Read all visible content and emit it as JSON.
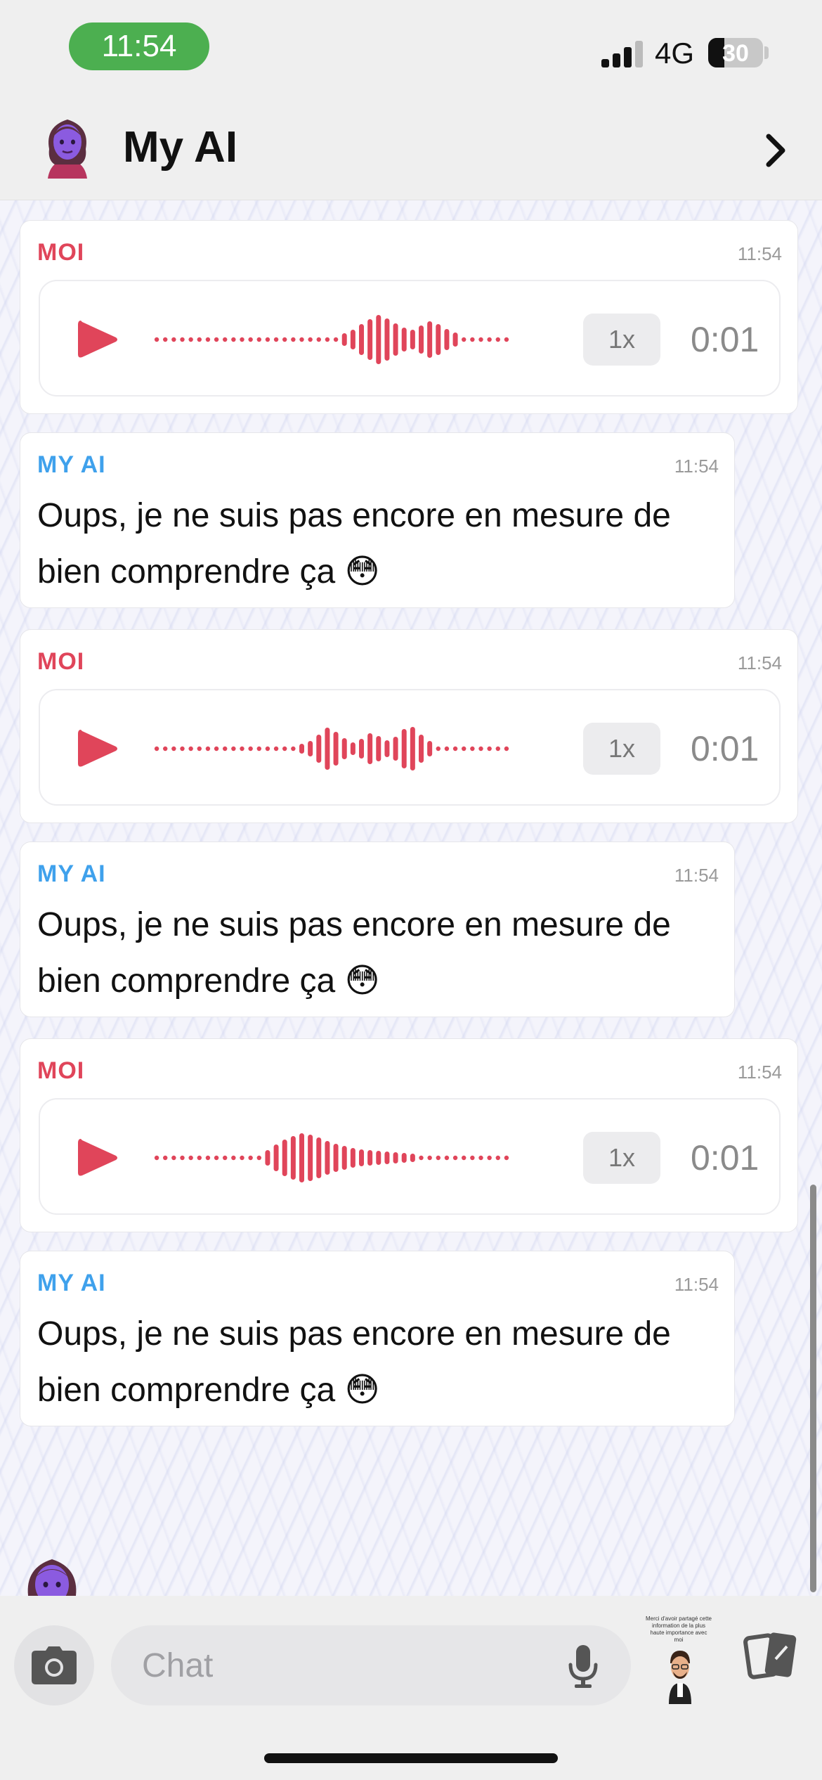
{
  "status_bar": {
    "time": "11:54",
    "network": "4G",
    "battery_percent": "30",
    "battery_level": 0.3,
    "time_pill_color": "#4caf50"
  },
  "header": {
    "title": "My AI",
    "avatar_icon": "bitmoji-avatar-icon",
    "chevron_icon": "chevron-right-icon"
  },
  "messages": [
    {
      "type": "voice",
      "sender": "MOI",
      "time": "11:54",
      "speed": "1x",
      "duration": "0:01"
    },
    {
      "type": "text",
      "sender": "MY AI",
      "time": "11:54",
      "text": "Oups, je ne suis pas encore en mesure de bien comprendre ça 😳"
    },
    {
      "type": "voice",
      "sender": "MOI",
      "time": "11:54",
      "speed": "1x",
      "duration": "0:01"
    },
    {
      "type": "text",
      "sender": "MY AI",
      "time": "11:54",
      "text": "Oups, je ne suis pas encore en mesure de bien comprendre ça 😳"
    },
    {
      "type": "voice",
      "sender": "MOI",
      "time": "11:54",
      "speed": "1x",
      "duration": "0:01"
    },
    {
      "type": "text",
      "sender": "MY AI",
      "time": "11:54",
      "text": "Oups, je ne suis pas encore en mesure de bien comprendre ça 😳"
    }
  ],
  "colors": {
    "me_accent": "#e0455a",
    "ai_accent": "#3fa1ec"
  },
  "input_bar": {
    "placeholder": "Chat",
    "camera_icon": "camera-icon",
    "mic_icon": "microphone-icon",
    "cards_icon": "cards-icon",
    "sticker_caption": "Merci d'avoir partagé cette information de la plus haute importance avec moi"
  }
}
